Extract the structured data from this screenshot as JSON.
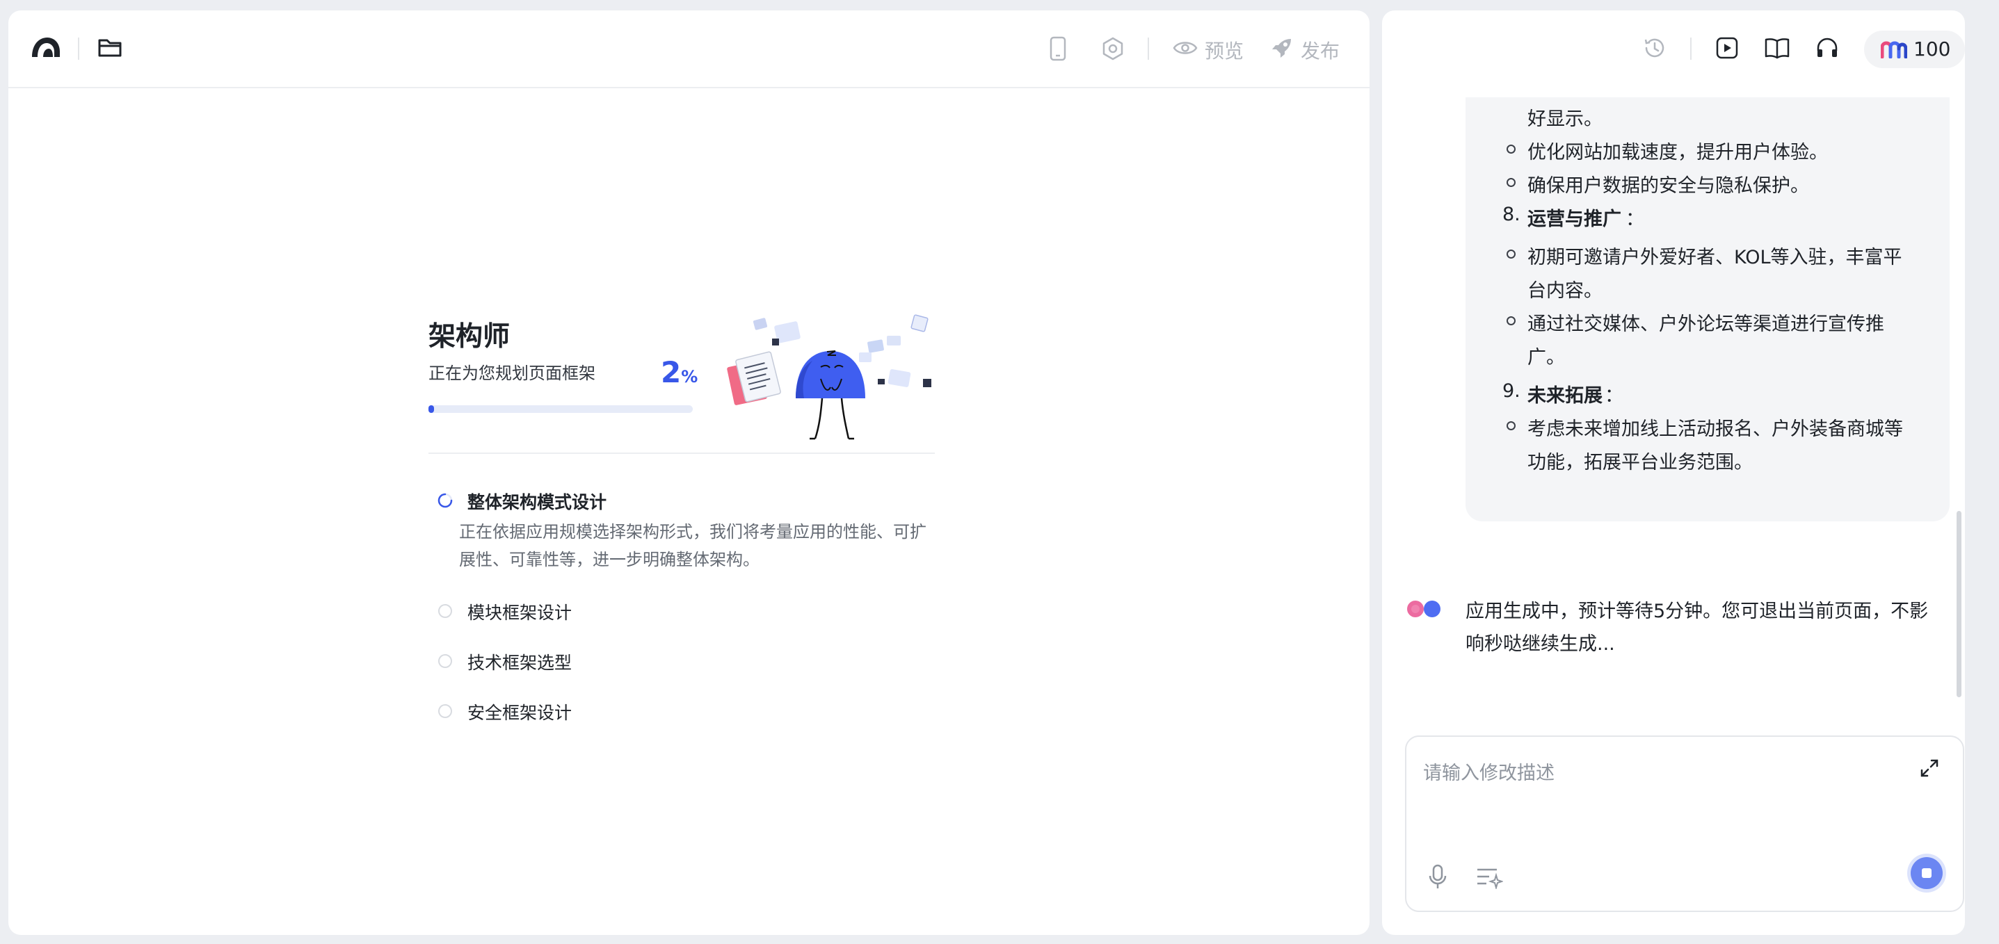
{
  "header": {
    "preview_label": "预览",
    "publish_label": "发布"
  },
  "progress": {
    "title": "架构师",
    "subtitle": "正在为您规划页面框架",
    "percent_value": "2",
    "percent_sign": "%",
    "fraction": 0.02,
    "steps": [
      {
        "label": "整体架构模式设计",
        "state": "active",
        "description": "正在依据应用规模选择架构形式，我们将考量应用的性能、可扩展性、可靠性等，进一步明确整体架构。"
      },
      {
        "label": "模块框架设计",
        "state": "pending"
      },
      {
        "label": "技术框架选型",
        "state": "pending"
      },
      {
        "label": "安全框架设计",
        "state": "pending"
      }
    ]
  },
  "right_header": {
    "credits": "100"
  },
  "chat": {
    "lines": [
      {
        "kind": "cont",
        "text": "好显示。"
      },
      {
        "kind": "bullet",
        "text": "优化网站加载速度，提升用户体验。"
      },
      {
        "kind": "bullet",
        "text": "确保用户数据的安全与隐私保护。"
      },
      {
        "kind": "heading",
        "num": "8.",
        "text": "运营与推广",
        "colon": "："
      },
      {
        "kind": "bullet",
        "text": "初期可邀请户外爱好者、KOL等入驻，丰富平"
      },
      {
        "kind": "cont",
        "text": "台内容。"
      },
      {
        "kind": "bullet",
        "text": "通过社交媒体、户外论坛等渠道进行宣传推"
      },
      {
        "kind": "cont",
        "text": "广。"
      },
      {
        "kind": "heading",
        "num": "9.",
        "text": "未来拓展",
        "colon": "："
      },
      {
        "kind": "bullet",
        "text": "考虑未来增加线上活动报名、户外装备商城等"
      },
      {
        "kind": "cont",
        "text": "功能，拓展平台业务范围。"
      }
    ],
    "status_line_1": "应用生成中，预计等待5分钟。您可退出当前页面，不影",
    "status_line_2": "响秒哒继续生成..."
  },
  "input": {
    "placeholder": "请输入修改描述"
  },
  "colors": {
    "accent": "#3857e8",
    "mascot": "#3f5ef0"
  },
  "icons": [
    "logo-icon",
    "folder-icon",
    "mobile-icon",
    "settings-icon",
    "eye-icon",
    "rocket-icon",
    "history-icon",
    "play-icon",
    "book-icon",
    "headset-icon",
    "brand-icon",
    "expand-icon",
    "microphone-icon",
    "prompt-icon",
    "stop-icon"
  ]
}
